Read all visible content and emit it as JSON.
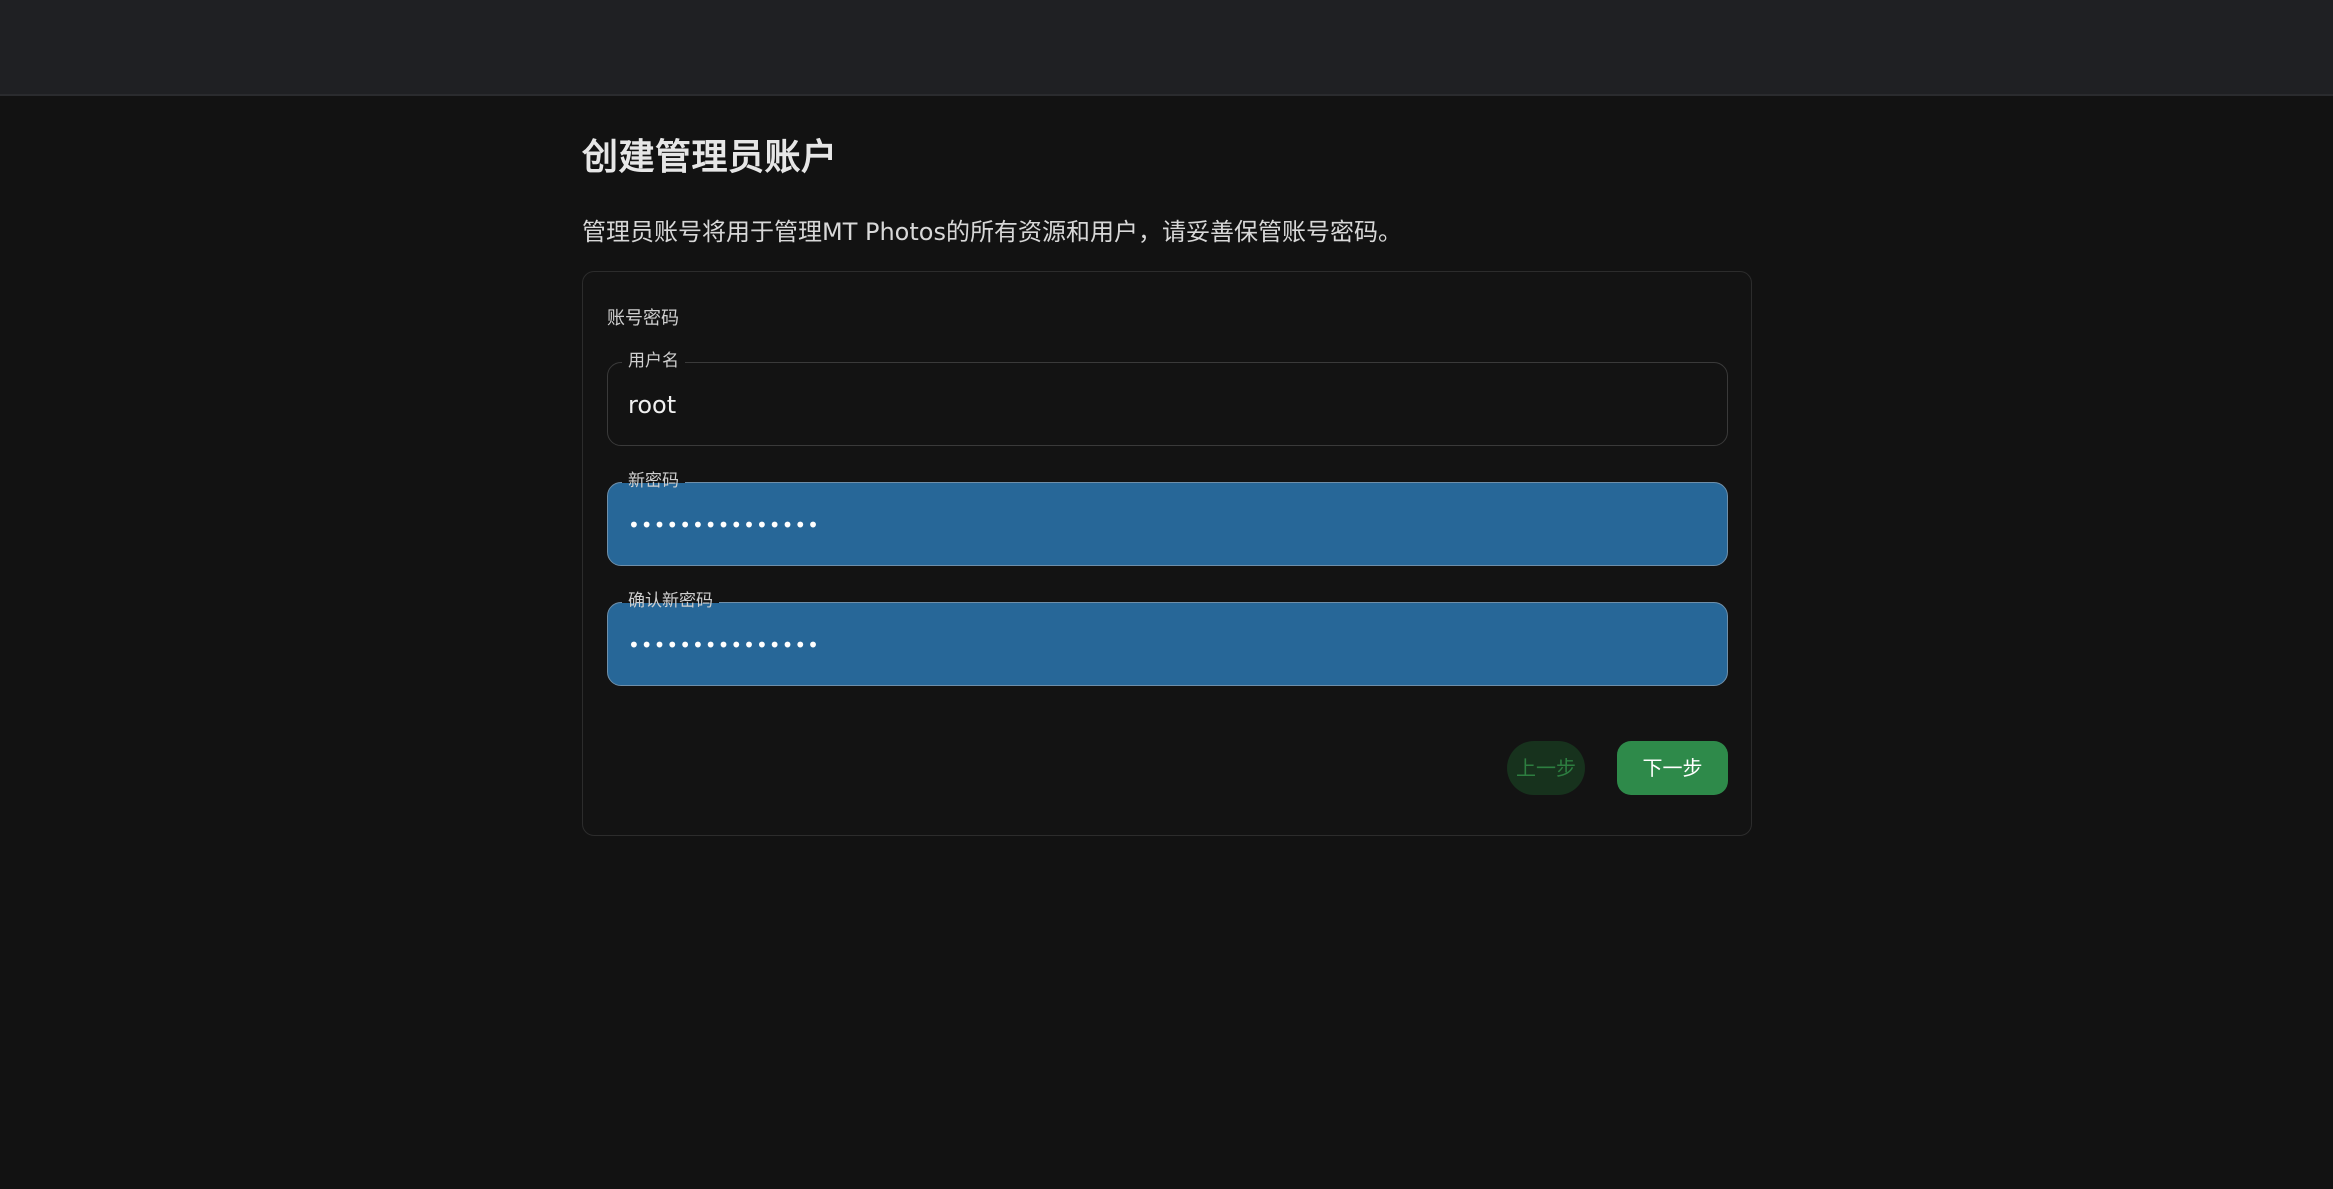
{
  "page": {
    "title": "创建管理员账户",
    "description": "管理员账号将用于管理MT Photos的所有资源和用户，请妥善保管账号密码。"
  },
  "form": {
    "section_label": "账号密码",
    "username": {
      "label": "用户名",
      "value": "root"
    },
    "new_password": {
      "label": "新密码",
      "value": "•••••••••••••••"
    },
    "confirm_password": {
      "label": "确认新密码",
      "value": "•••••••••••••••"
    }
  },
  "actions": {
    "prev_label": "上一步",
    "next_label": "下一步"
  },
  "colors": {
    "background": "#121212",
    "topbar": "#1f2023",
    "autofill_blue": "#276798",
    "primary_green": "#2e8a4a",
    "disabled_green": "#17321d"
  }
}
